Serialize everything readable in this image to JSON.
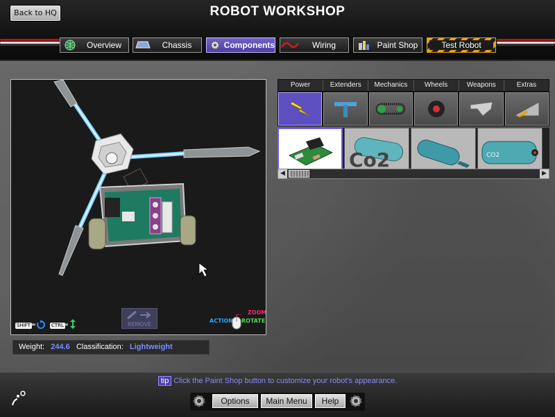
{
  "header": {
    "back_label": "Back to HQ",
    "title": "ROBOT WORKSHOP",
    "tabs": [
      {
        "label": "Overview",
        "icon": "globe-icon",
        "active": false
      },
      {
        "label": "Chassis",
        "icon": "chassis-icon",
        "active": false
      },
      {
        "label": "Components",
        "icon": "gear-icon",
        "active": true
      },
      {
        "label": "Wiring",
        "icon": "wire-icon",
        "active": false
      },
      {
        "label": "Paint Shop",
        "icon": "paint-cans-icon",
        "active": false
      },
      {
        "label": "Test Robot",
        "icon": "",
        "active": false
      }
    ],
    "accent_color": "#5e4fc0"
  },
  "viewport": {
    "shift_key": "SHIFT",
    "ctrl_key": "CTRL",
    "remove_label": "REMOVE",
    "action_label": "ACTION",
    "zoom_label": "ZOOM",
    "rotate_label": "ROTATE"
  },
  "stats": {
    "weight_label": "Weight:",
    "weight_value": "244.6",
    "class_label": "Classification:",
    "class_value": "Lightweight"
  },
  "picker": {
    "categories": [
      {
        "label": "Power",
        "icon": "lightning-icon",
        "active": true
      },
      {
        "label": "Extenders",
        "icon": "extender-icon",
        "active": false
      },
      {
        "label": "Mechanics",
        "icon": "chain-drive-icon",
        "active": false
      },
      {
        "label": "Wheels",
        "icon": "wheel-icon",
        "active": false
      },
      {
        "label": "Weapons",
        "icon": "weapon-icon",
        "active": false
      },
      {
        "label": "Extras",
        "icon": "wedge-icon",
        "active": false
      }
    ],
    "parts": [
      {
        "icon": "circuit-board-icon",
        "selected": true,
        "text": ""
      },
      {
        "icon": "co2-canister-icon",
        "selected": false,
        "text": "Co2"
      },
      {
        "icon": "tank-icon",
        "selected": false,
        "text": ""
      },
      {
        "icon": "co2-tank-icon",
        "selected": false,
        "text": "CO2"
      }
    ]
  },
  "footer": {
    "tip_badge": "tip",
    "tip_text": "Click the Paint Shop button to customize your robot's appearance.",
    "options_label": "Options",
    "main_menu_label": "Main Menu",
    "help_label": "Help"
  }
}
